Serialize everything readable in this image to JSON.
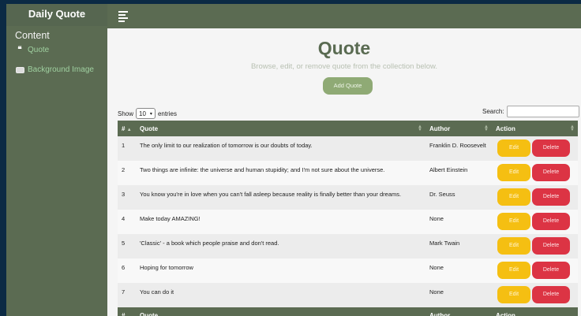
{
  "sidebar": {
    "brand": "Daily Quote",
    "heading": "Content",
    "items": [
      {
        "label": "Quote",
        "icon": "quote-icon"
      },
      {
        "label": "Background Image",
        "icon": "image-icon"
      }
    ]
  },
  "main": {
    "title": "Quote",
    "subtitle": "Browse, edit, or remove quote from the collection below.",
    "add_button": "Add Quote",
    "show_label": "Show",
    "entries_value": "10",
    "entries_label": "entries",
    "search_label": "Search:"
  },
  "table": {
    "headers": [
      "#",
      "Quote",
      "Author",
      "Action"
    ],
    "rows": [
      {
        "num": "1",
        "quote": "The only limit to our realization of tomorrow is our doubts of today.",
        "author": "Franklin D. Roosevelt"
      },
      {
        "num": "2",
        "quote": "Two things are infinite: the universe and human stupidity; and I'm not sure about the universe.",
        "author": "Albert Einstein"
      },
      {
        "num": "3",
        "quote": "You know you're in love when you can't fall asleep because reality is finally better than your dreams.",
        "author": "Dr. Seuss"
      },
      {
        "num": "4",
        "quote": "Make today AMAZING!",
        "author": "None"
      },
      {
        "num": "5",
        "quote": "'Classic' - a book which people praise and don't read.",
        "author": "Mark Twain"
      },
      {
        "num": "6",
        "quote": "Hoping for tomorrow",
        "author": "None"
      },
      {
        "num": "7",
        "quote": "You can do it",
        "author": "None"
      }
    ],
    "edit_label": "Edit",
    "delete_label": "Delete"
  },
  "colors": {
    "sidebar": "#5b6b52",
    "accent_green": "#8faa75",
    "edit": "#f5bf12",
    "delete": "#dc3444"
  }
}
